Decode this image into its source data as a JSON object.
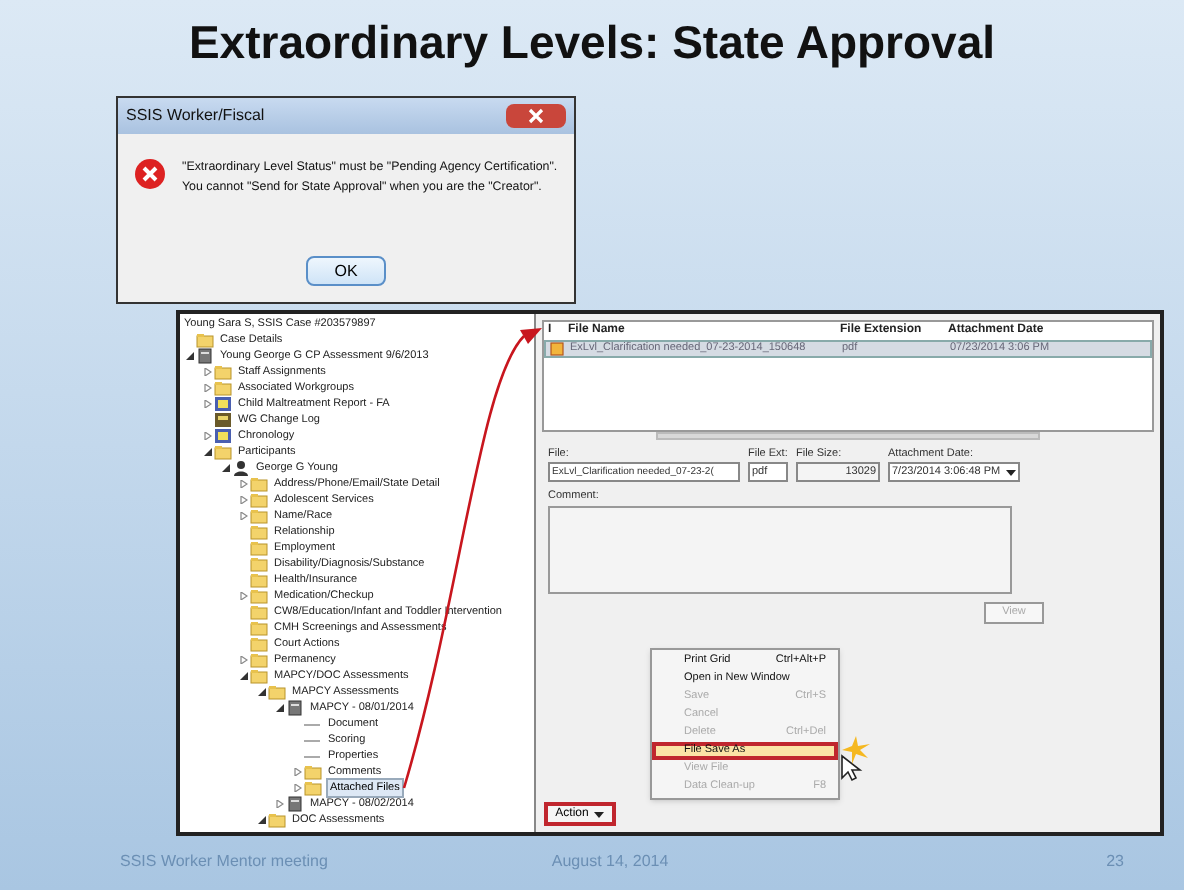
{
  "slide": {
    "title": "Extraordinary Levels: State Approval",
    "footer_left": "SSIS Worker Mentor meeting",
    "footer_date": "August 14, 2014",
    "page_number": "23"
  },
  "dialog": {
    "title": "SSIS Worker/Fiscal",
    "message": [
      "\"Extraordinary Level Status\" must be \"Pending Agency Certification\".",
      "You cannot \"Send for State Approval\" when you are the \"Creator\"."
    ],
    "button": "OK"
  },
  "tree": {
    "header": "Young Sara S, SSIS Case #203579897",
    "items": [
      {
        "label": "Case Details",
        "kind": "folder",
        "selected": false
      },
      {
        "label": "Young George G CP Assessment 9/6/2013",
        "kind": "doc",
        "expanded": true,
        "selected": false,
        "children": [
          {
            "label": "Staff Assignments",
            "kind": "folder",
            "expanded": false,
            "selected": false
          },
          {
            "label": "Associated Workgroups",
            "kind": "folder",
            "expanded": false,
            "selected": false
          },
          {
            "label": "Child Maltreatment Report - FA",
            "kind": "report",
            "expanded": false,
            "selected": false
          },
          {
            "label": "WG Change Log",
            "kind": "log",
            "selected": false
          },
          {
            "label": "Chronology",
            "kind": "report",
            "expanded": false,
            "selected": false
          },
          {
            "label": "Participants",
            "kind": "folder",
            "expanded": true,
            "selected": false,
            "children": [
              {
                "label": "George G Young",
                "kind": "person",
                "expanded": true,
                "selected": false,
                "children": [
                  {
                    "label": "Address/Phone/Email/State Detail",
                    "kind": "folder",
                    "expanded": false,
                    "selected": false
                  },
                  {
                    "label": "Adolescent Services",
                    "kind": "folder",
                    "expanded": false,
                    "selected": false
                  },
                  {
                    "label": "Name/Race",
                    "kind": "folder",
                    "expanded": false,
                    "selected": false
                  },
                  {
                    "label": "Relationship",
                    "kind": "folder",
                    "selected": false
                  },
                  {
                    "label": "Employment",
                    "kind": "folder",
                    "selected": false
                  },
                  {
                    "label": "Disability/Diagnosis/Substance",
                    "kind": "folder",
                    "selected": false
                  },
                  {
                    "label": "Health/Insurance",
                    "kind": "folder",
                    "selected": false
                  },
                  {
                    "label": "Medication/Checkup",
                    "kind": "folder",
                    "expanded": false,
                    "selected": false
                  },
                  {
                    "label": "CW8/Education/Infant and Toddler Intervention",
                    "kind": "folder",
                    "selected": false
                  },
                  {
                    "label": "CMH Screenings and Assessments",
                    "kind": "folder",
                    "selected": false
                  },
                  {
                    "label": "Court Actions",
                    "kind": "folder",
                    "selected": false
                  },
                  {
                    "label": "Permanency",
                    "kind": "folder",
                    "expanded": false,
                    "selected": false
                  },
                  {
                    "label": "MAPCY/DOC Assessments",
                    "kind": "folder",
                    "expanded": true,
                    "selected": false,
                    "children": [
                      {
                        "label": "MAPCY Assessments",
                        "kind": "folder",
                        "expanded": true,
                        "selected": false,
                        "children": [
                          {
                            "label": "MAPCY - 08/01/2014",
                            "kind": "doc",
                            "expanded": true,
                            "selected": false,
                            "children": [
                              {
                                "label": "Document",
                                "kind": "leaf",
                                "selected": false
                              },
                              {
                                "label": "Scoring",
                                "kind": "leaf",
                                "selected": false
                              },
                              {
                                "label": "Properties",
                                "kind": "leaf",
                                "selected": false
                              },
                              {
                                "label": "Comments",
                                "kind": "folder",
                                "expanded": false,
                                "selected": false
                              },
                              {
                                "label": "Attached Files",
                                "kind": "folder",
                                "expanded": false,
                                "selected": true
                              }
                            ]
                          },
                          {
                            "label": "MAPCY - 08/02/2014",
                            "kind": "doc",
                            "expanded": false,
                            "selected": false
                          }
                        ]
                      },
                      {
                        "label": "DOC Assessments",
                        "kind": "folder",
                        "expanded": true,
                        "selected": false
                      }
                    ]
                  }
                ]
              }
            ]
          }
        ]
      }
    ]
  },
  "grid": {
    "marker_header": "I",
    "columns": [
      "File Name",
      "File Extension",
      "Attachment Date"
    ],
    "rows": [
      {
        "cells": [
          "ExLvl_Clarification needed_07-23-2014_150648",
          "pdf",
          "07/23/2014 3:06 PM"
        ],
        "selected": true
      }
    ]
  },
  "form": {
    "file_label": "File:",
    "file_value": "ExLvl_Clarification needed_07-23-2(",
    "ext_label": "File Ext:",
    "ext_value": "pdf",
    "size_label": "File Size:",
    "size_value": "13029",
    "date_label": "Attachment Date:",
    "date_value": "7/23/2014 3:06:48 PM",
    "comment_label": "Comment:",
    "view_button": "View"
  },
  "menu": {
    "items": [
      {
        "label": "Print Grid",
        "shortcut": "Ctrl+Alt+P",
        "disabled": false,
        "selected": false
      },
      {
        "label": "Open in New Window",
        "disabled": false,
        "selected": false
      },
      {
        "label": "Save",
        "shortcut": "Ctrl+S",
        "disabled": true,
        "selected": false
      },
      {
        "label": "Cancel",
        "disabled": true,
        "selected": false
      },
      {
        "label": "Delete",
        "shortcut": "Ctrl+Del",
        "disabled": true,
        "selected": false
      },
      {
        "label": "File Save As",
        "disabled": false,
        "selected": true
      },
      {
        "label": "View File",
        "disabled": true,
        "selected": false
      },
      {
        "label": "Data Clean-up",
        "shortcut": "F8",
        "disabled": true,
        "selected": false
      }
    ]
  },
  "action_button": "Action"
}
